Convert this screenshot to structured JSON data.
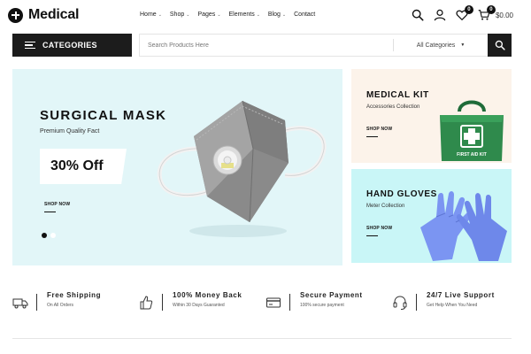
{
  "brand": {
    "name": "Medical"
  },
  "nav": [
    {
      "label": "Home",
      "has_dropdown": true
    },
    {
      "label": "Shop",
      "has_dropdown": true
    },
    {
      "label": "Pages",
      "has_dropdown": true
    },
    {
      "label": "Elements",
      "has_dropdown": true
    },
    {
      "label": "Blog",
      "has_dropdown": true
    },
    {
      "label": "Contact",
      "has_dropdown": false
    }
  ],
  "header_icons": {
    "search": "search-icon",
    "account": "user-icon",
    "wishlist": {
      "icon": "heart-icon",
      "count": "0"
    },
    "cart": {
      "icon": "cart-icon",
      "count": "0",
      "total": "$0.00"
    }
  },
  "categories_button": {
    "label": "CATEGORIES",
    "icon": "hamburger-icon"
  },
  "search": {
    "placeholder": "Search Products Here",
    "category_selected": "All Categories",
    "button_icon": "search-icon"
  },
  "hero": {
    "title": "SURGICAL MASK",
    "subtitle": "Premium Quality Fact",
    "promo": "30% Off",
    "cta": "SHOP NOW",
    "slides": 2,
    "active_slide": 1,
    "background": "#e2f6f8"
  },
  "banners": [
    {
      "title": "MEDICAL KIT",
      "subtitle": "Accessories Collection",
      "cta": "SHOP NOW",
      "background": "#fcf3ea"
    },
    {
      "title": "HAND GLOVES",
      "subtitle": "Meter Collection",
      "cta": "SHOP NOW",
      "background": "#c9f6f7"
    }
  ],
  "features": [
    {
      "icon": "truck-icon",
      "title": "Free Shipping",
      "subtitle": "On All Orders"
    },
    {
      "icon": "thumbs-up-icon",
      "title": "100% Money Back",
      "subtitle": "Within 30 Days Guaranted"
    },
    {
      "icon": "credit-card-icon",
      "title": "Secure Payment",
      "subtitle": "100% secure payment"
    },
    {
      "icon": "headset-icon",
      "title": "24/7 Live Support",
      "subtitle": "Get Help When You Need"
    }
  ],
  "colors": {
    "dark": "#1c1c1c",
    "accent_green": "#2f8a4c",
    "glove_blue": "#7b95f2"
  }
}
